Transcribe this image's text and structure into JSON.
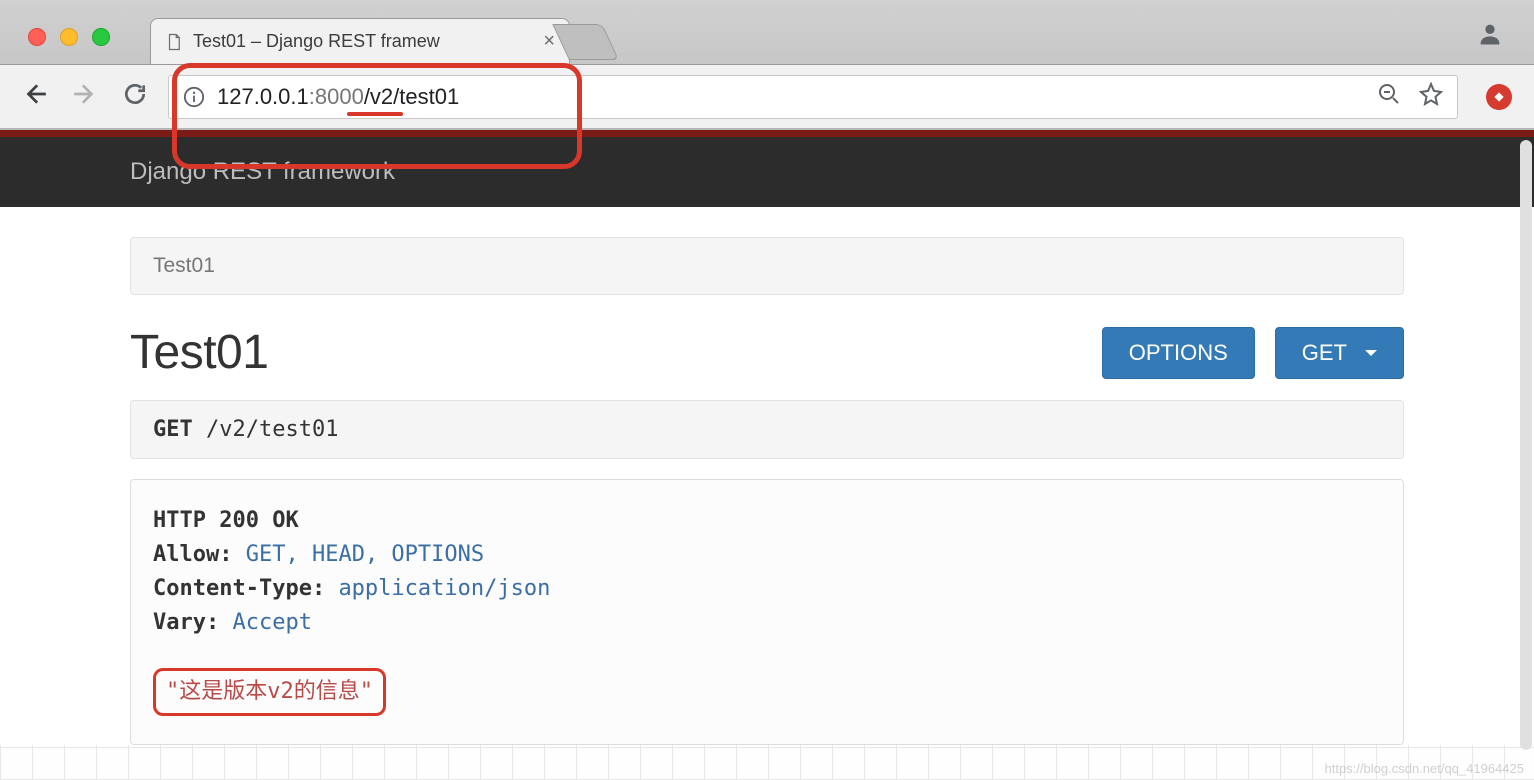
{
  "browser": {
    "tab_title": "Test01 – Django REST framew",
    "url_domain": "127.0.0.1",
    "url_port": ":8000",
    "url_path": "/v2/test01"
  },
  "navbar": {
    "brand": "Django REST framework"
  },
  "breadcrumb": {
    "current": "Test01"
  },
  "page": {
    "title": "Test01"
  },
  "buttons": {
    "options": "OPTIONS",
    "get": "GET"
  },
  "request": {
    "method": "GET",
    "path": "/v2/test01"
  },
  "response": {
    "status_line": "HTTP 200 OK",
    "headers": [
      {
        "key": "Allow:",
        "value": "GET, HEAD, OPTIONS"
      },
      {
        "key": "Content-Type:",
        "value": "application/json"
      },
      {
        "key": "Vary:",
        "value": "Accept"
      }
    ],
    "body": "\"这是版本v2的信息\""
  },
  "watermark": "https://blog.csdn.net/qq_41964425"
}
